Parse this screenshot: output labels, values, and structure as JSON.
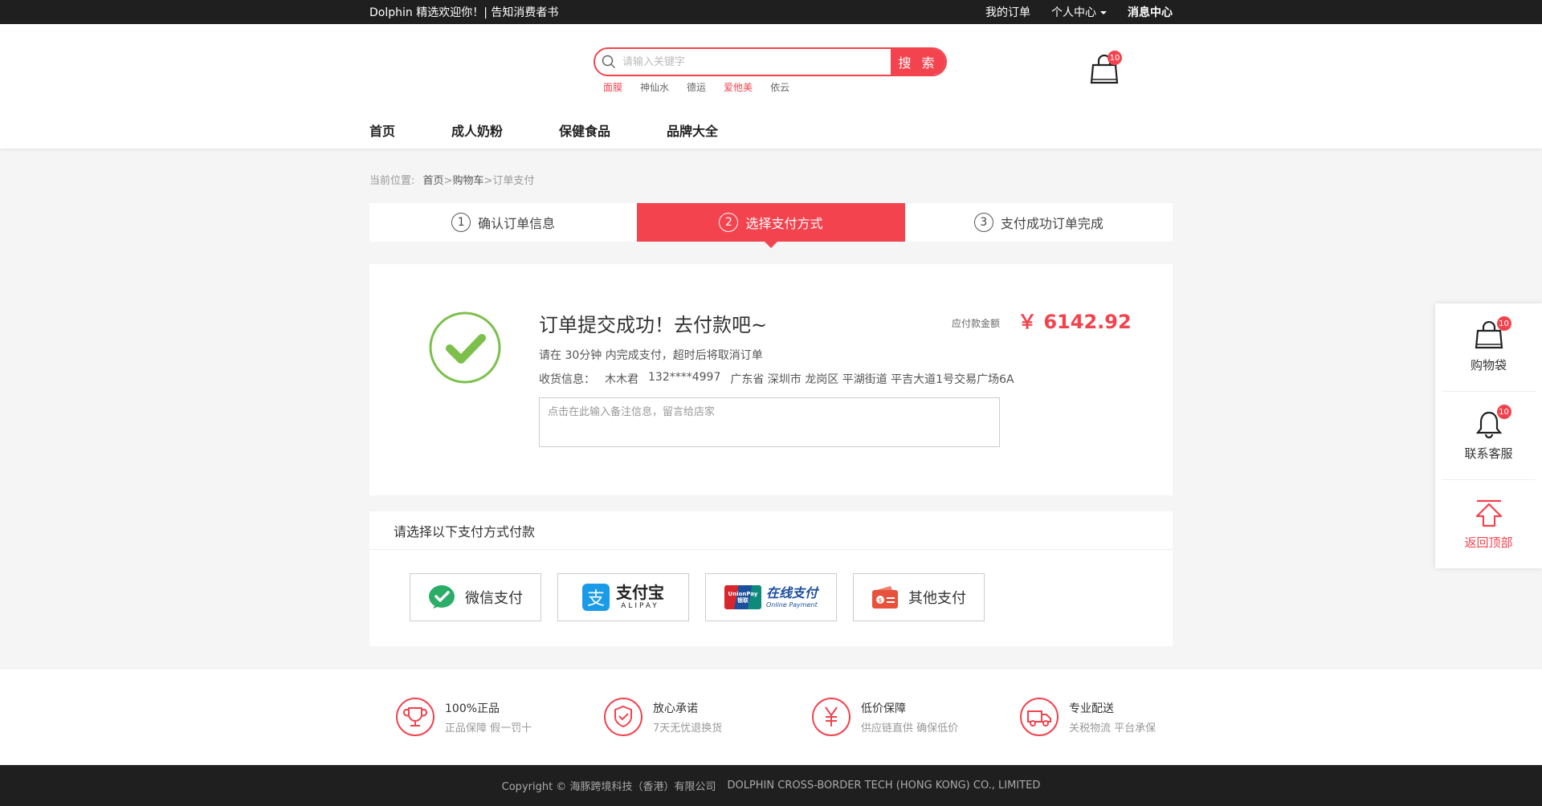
{
  "topbar": {
    "welcome": "Dolphin 精选欢迎你！| 告知消费者书",
    "my_orders": "我的订单",
    "personal_center": "个人中心",
    "messages": "消息中心"
  },
  "search": {
    "placeholder": "请输入关键字",
    "button": "搜 索",
    "hotwords": [
      {
        "text": "面膜",
        "highlight": true
      },
      {
        "text": "神仙水",
        "highlight": false
      },
      {
        "text": "德运",
        "highlight": false
      },
      {
        "text": "爱他美",
        "highlight": true
      },
      {
        "text": "依云",
        "highlight": false
      }
    ]
  },
  "cart": {
    "count": "10"
  },
  "nav": [
    "首页",
    "成人奶粉",
    "保健食品",
    "品牌大全"
  ],
  "breadcrumb": {
    "prefix": "当前位置:",
    "home": "首页",
    "sep1": ">",
    "cart": "购物车",
    "sep2": ">",
    "current": "订单支付"
  },
  "steps": [
    {
      "num": "1",
      "label": "确认订单信息",
      "active": false
    },
    {
      "num": "2",
      "label": "选择支付方式",
      "active": true
    },
    {
      "num": "3",
      "label": "支付成功订单完成",
      "active": false
    }
  ],
  "order": {
    "title": "订单提交成功！去付款吧~",
    "amount_label": "应付款金额",
    "amount": "￥ 6142.92",
    "tip": "请在 30分钟 内完成支付，超时后将取消订单",
    "address_label": "收货信息：",
    "name": "木木君",
    "phone": "132****4997",
    "address": "广东省 深圳市 龙岗区 平湖街道 平吉大道1号交易广场6A",
    "note_placeholder": "点击在此输入备注信息，留言给店家"
  },
  "payment": {
    "heading": "请选择以下支付方式付款",
    "methods": {
      "wechat": "微信支付",
      "alipay_cn": "支付宝",
      "alipay_en": "ALIPAY",
      "unionpay_cn": "在线支付",
      "unionpay_en": "Online Payment",
      "unionpay_logo": "UnionPay",
      "unionpay_logo_cn": "银联",
      "other": "其他支付"
    }
  },
  "guarantees": [
    {
      "title": "100%正品",
      "sub": "正品保障  假一罚十"
    },
    {
      "title": "放心承诺",
      "sub": "7天无忧退换货"
    },
    {
      "title": "低价保障",
      "sub": "供应链直供  确保低价"
    },
    {
      "title": "专业配送",
      "sub": "关税物流 平台承保"
    }
  ],
  "footer": {
    "copyright": "Copyright ©  海豚跨境科技（香港）有限公司",
    "english": "DOLPHIN CROSS-BORDER TECH (HONG KONG) CO., LIMITED"
  },
  "sidebar": {
    "bag": "购物袋",
    "bag_count": "10",
    "service": "联系客服",
    "service_count": "10",
    "top": "返回顶部"
  },
  "colors": {
    "accent": "#f2434e",
    "success": "#7cc04b",
    "wechat": "#2aae67",
    "alipay": "#1a9be8"
  }
}
